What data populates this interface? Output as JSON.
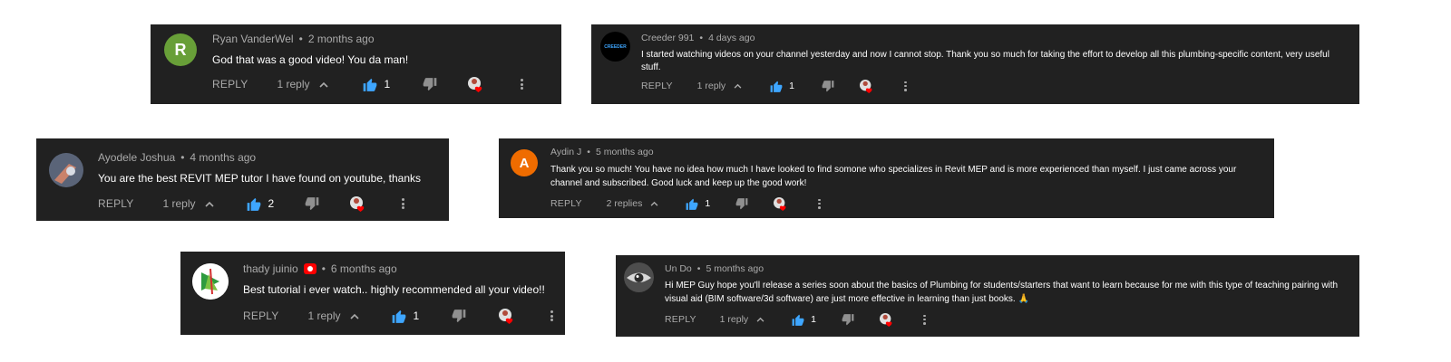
{
  "colors": {
    "card_bg": "#212121",
    "meta": "#aaaaaa",
    "like_blue": "#3ea6ff",
    "heart_red": "#ff0000"
  },
  "comments": [
    {
      "author": "Ryan VanderWel",
      "time": "2 months ago",
      "avatar_letter": "R",
      "avatar_color": "#689f38",
      "text": "God that was a good video!  You da man!",
      "reply_label": "REPLY",
      "replies": "1 reply",
      "likes": "1"
    },
    {
      "author": "Creeder 991",
      "time": "4 days ago",
      "avatar_text": "CREEDER",
      "avatar_color": "#000000",
      "text": "I started watching videos on your channel yesterday and now I cannot stop. Thank you so much for taking the effort to develop all this plumbing-specific content, very useful stuff.",
      "reply_label": "REPLY",
      "replies": "1 reply",
      "likes": "1"
    },
    {
      "author": "Ayodele Joshua",
      "time": "4 months ago",
      "avatar_icon": "photo-avatar",
      "text": "You are the best REVIT MEP tutor I have found on youtube, thanks",
      "reply_label": "REPLY",
      "replies": "1 reply",
      "likes": "2"
    },
    {
      "author": "Aydin J",
      "time": "5 months ago",
      "avatar_letter": "A",
      "avatar_color": "#ef6c00",
      "text": "Thank you so much! You have no idea how much I have looked to find somone who specializes in Revit MEP and is more experienced than myself. I just came across your channel and subscribed.  Good luck and keep up the good work!",
      "reply_label": "REPLY",
      "replies": "2 replies",
      "likes": "1"
    },
    {
      "author": "thady juinio",
      "time": "6 months ago",
      "avatar_icon": "logo-avatar",
      "badge_icon": "youtube-badge-icon",
      "text": "Best tutorial i ever watch.. highly recommended all your video!!",
      "reply_label": "REPLY",
      "replies": "1 reply",
      "likes": "1"
    },
    {
      "author": "Un Do",
      "time": "5 months ago",
      "avatar_icon": "eye-avatar",
      "text": "Hi MEP Guy hope you'll release a series soon about the basics of Plumbing for students/starters that want to learn because for me with this type of teaching pairing with visual aid (BIM software/3d software) are just more effective in learning than just books. 🙏",
      "reply_label": "REPLY",
      "replies": "1 reply",
      "likes": "1"
    }
  ]
}
